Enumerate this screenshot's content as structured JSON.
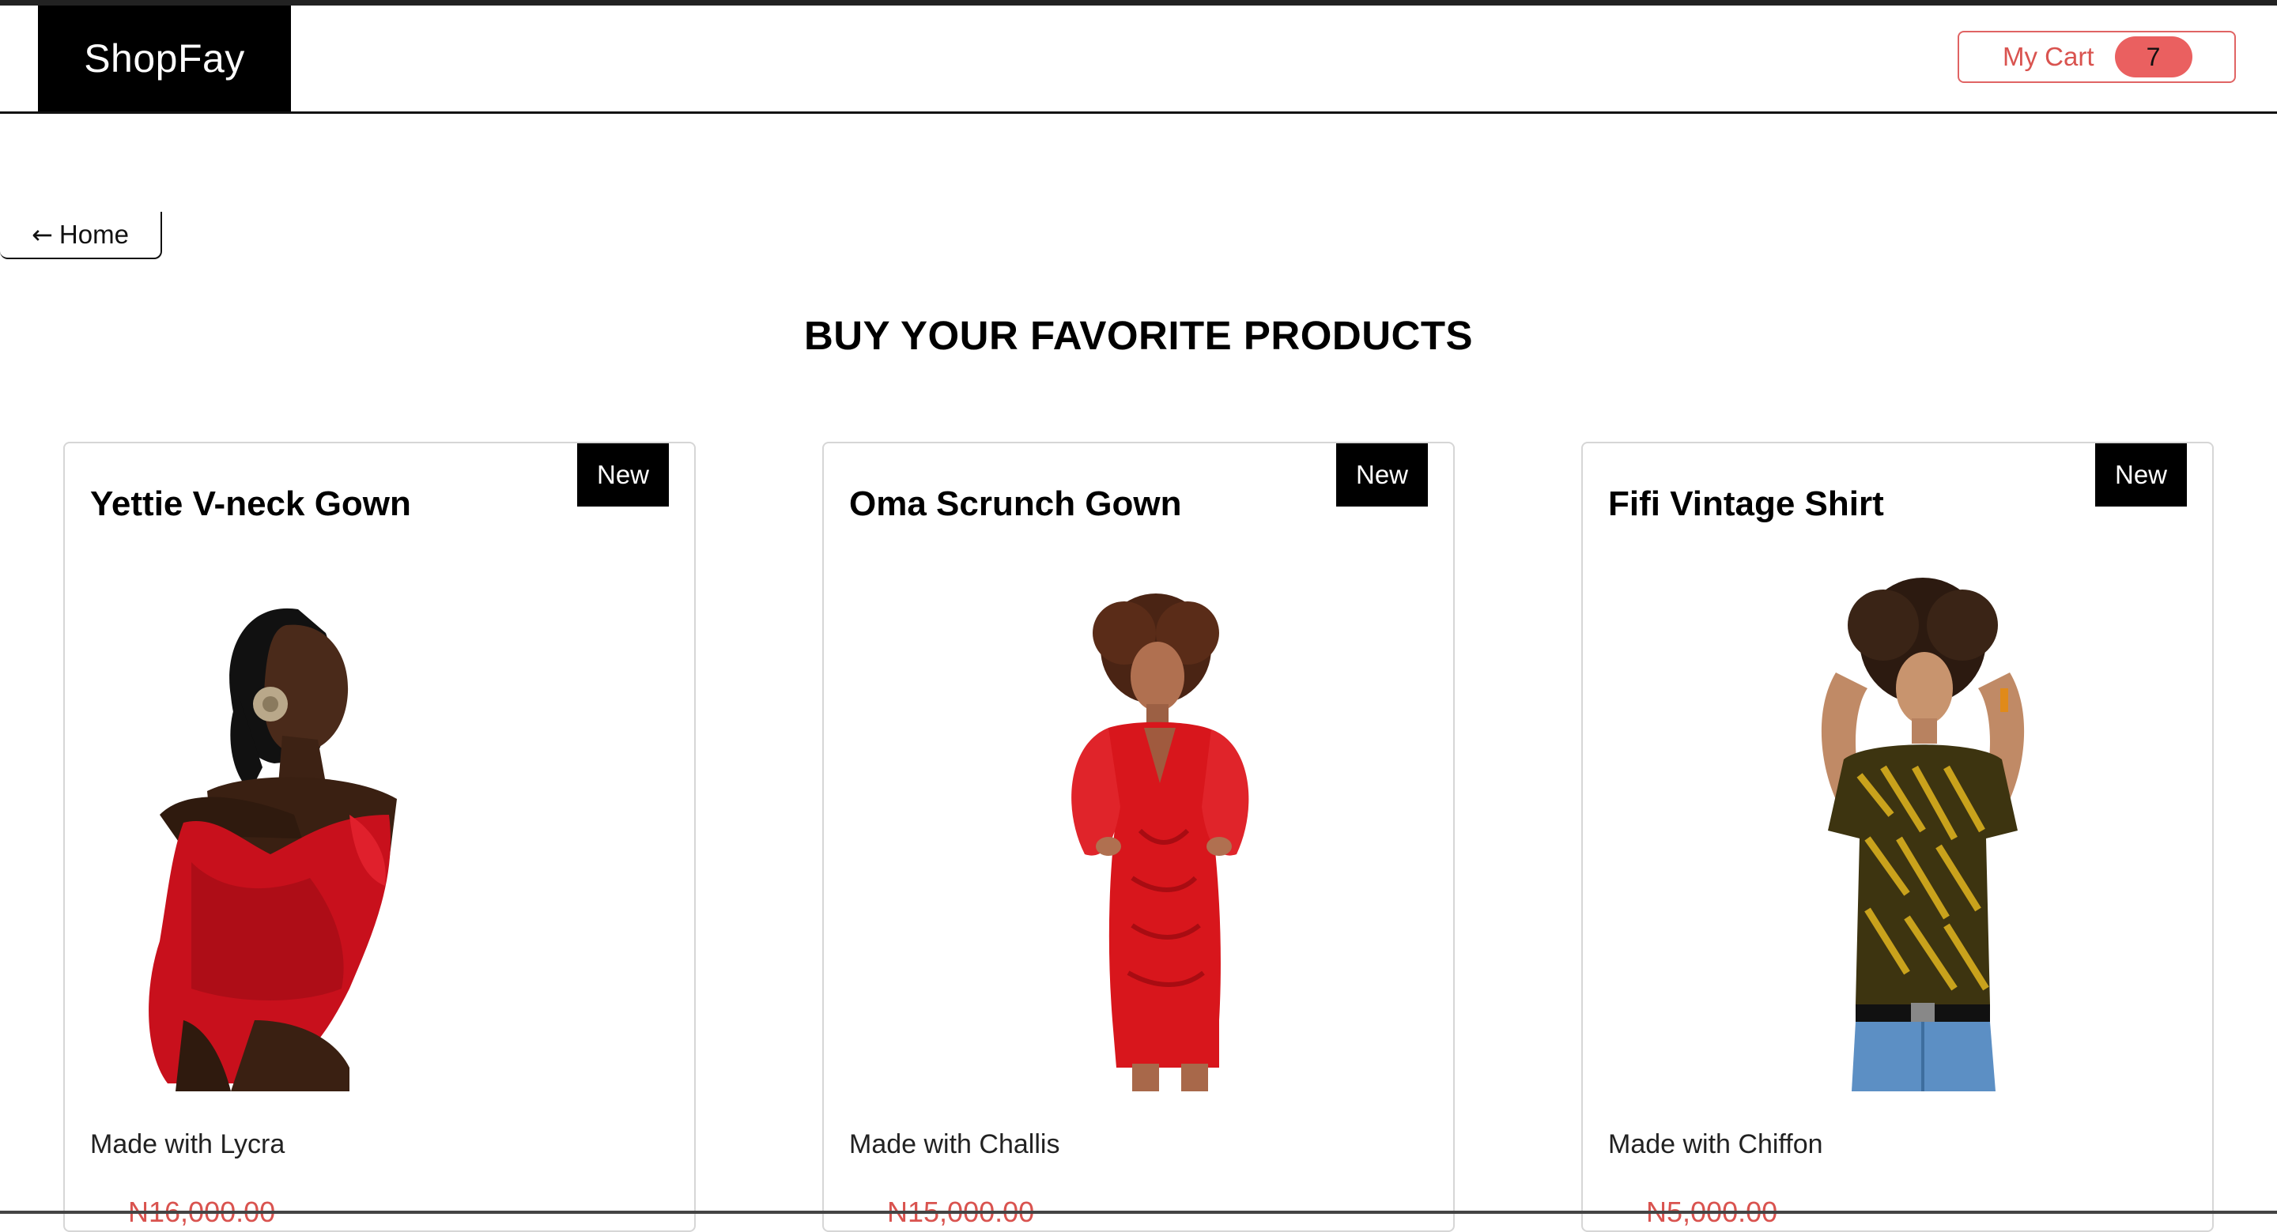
{
  "header": {
    "brand": "ShopFay",
    "cart_label": "My Cart",
    "cart_count": "7"
  },
  "nav": {
    "home_arrow": "←",
    "home_label": "Home"
  },
  "page_title": "BUY YOUR FAVORITE PRODUCTS",
  "products": [
    {
      "badge": "New",
      "name": "Yettie V-neck Gown",
      "image": "woman-red-ruffle-gown-photo",
      "description": "Made with Lycra",
      "price": "N16,000.00"
    },
    {
      "badge": "New",
      "name": "Oma Scrunch Gown",
      "image": "woman-red-scrunch-dress-photo",
      "description": "Made with Challis",
      "price": "N15,000.00"
    },
    {
      "badge": "New",
      "name": "Fifi Vintage Shirt",
      "image": "woman-tiger-print-shirt-photo",
      "description": "Made with Chiffon",
      "price": "N5,000.00"
    }
  ],
  "colors": {
    "accent": "#d9534f",
    "badge_bg": "#ea6060",
    "brand_bg": "#000000"
  }
}
